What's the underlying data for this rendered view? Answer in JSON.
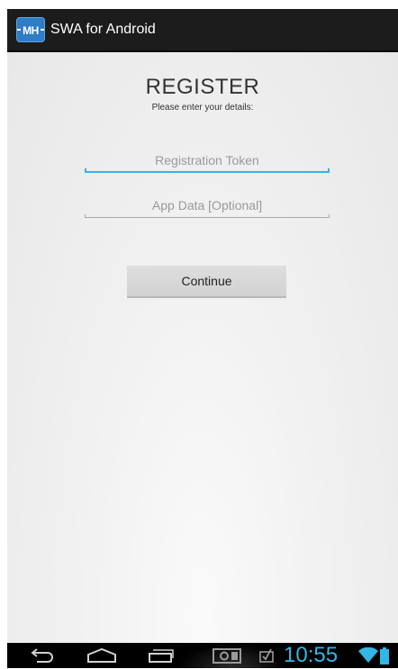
{
  "action_bar": {
    "logo_text": "MH",
    "title": "SWA for Android"
  },
  "register": {
    "title": "REGISTER",
    "subtitle": "Please enter your details:",
    "token_placeholder": "Registration Token",
    "token_value": "",
    "app_data_placeholder": "App Data [Optional]",
    "app_data_value": "",
    "continue_label": "Continue"
  },
  "status": {
    "time": "10:55"
  },
  "icons": {
    "back": "back-icon",
    "home": "home-icon",
    "recents": "recents-icon",
    "screenshot": "screenshot-icon",
    "notification": "notification-icon",
    "wifi": "wifi-icon",
    "battery": "battery-icon"
  },
  "colors": {
    "accent": "#33b5e5",
    "action_bar": "#1c1c1c",
    "logo": "#2f7dc4"
  }
}
